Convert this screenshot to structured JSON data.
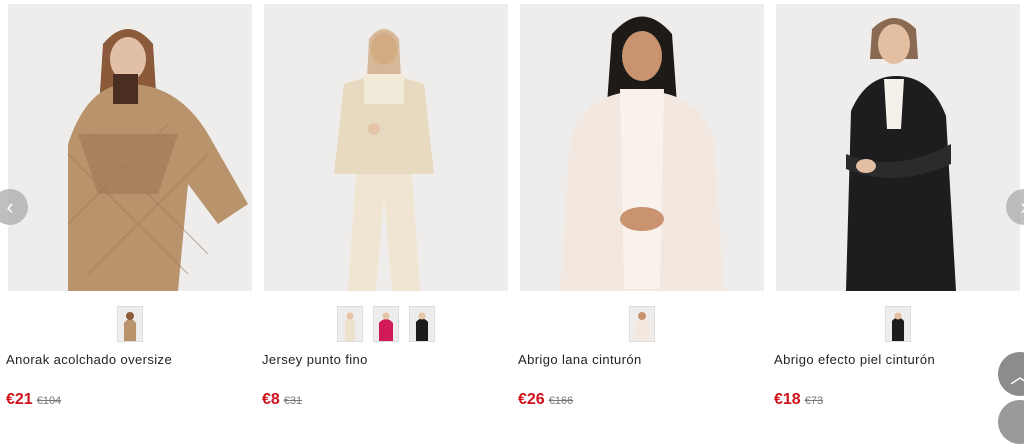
{
  "products": [
    {
      "name": "Anorak acolchado oversize",
      "price": "€21",
      "old_price": "€104"
    },
    {
      "name": "Jersey punto fino",
      "price": "€8",
      "old_price": "€31"
    },
    {
      "name": "Abrigo lana cinturón",
      "price": "€26",
      "old_price": "€166"
    },
    {
      "name": "Abrigo efecto piel cinturón",
      "price": "€18",
      "old_price": "€73"
    }
  ],
  "nav": {
    "prev_icon": "‹",
    "next_icon": "›",
    "scroll_top_icon": "︿"
  },
  "colors": {
    "sale": "#d0121b",
    "old": "#777777",
    "arrow": "#aaaaaa"
  }
}
